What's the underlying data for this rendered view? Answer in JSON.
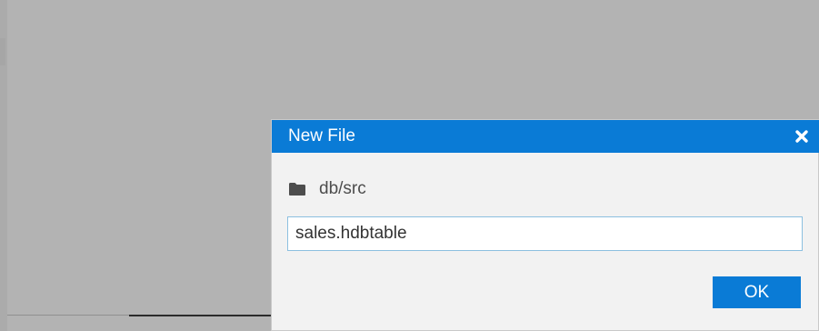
{
  "dialog": {
    "title": "New File",
    "close_icon": "close-icon",
    "folder_icon": "folder-icon",
    "path": "db/src",
    "filename_value": "sales.hdbtable",
    "ok_label": "OK"
  },
  "colors": {
    "header": "#0a7bd6",
    "overlay": "#b3b3b3",
    "input_border": "#8cc0e0",
    "ok_button": "#0a7bd6"
  }
}
